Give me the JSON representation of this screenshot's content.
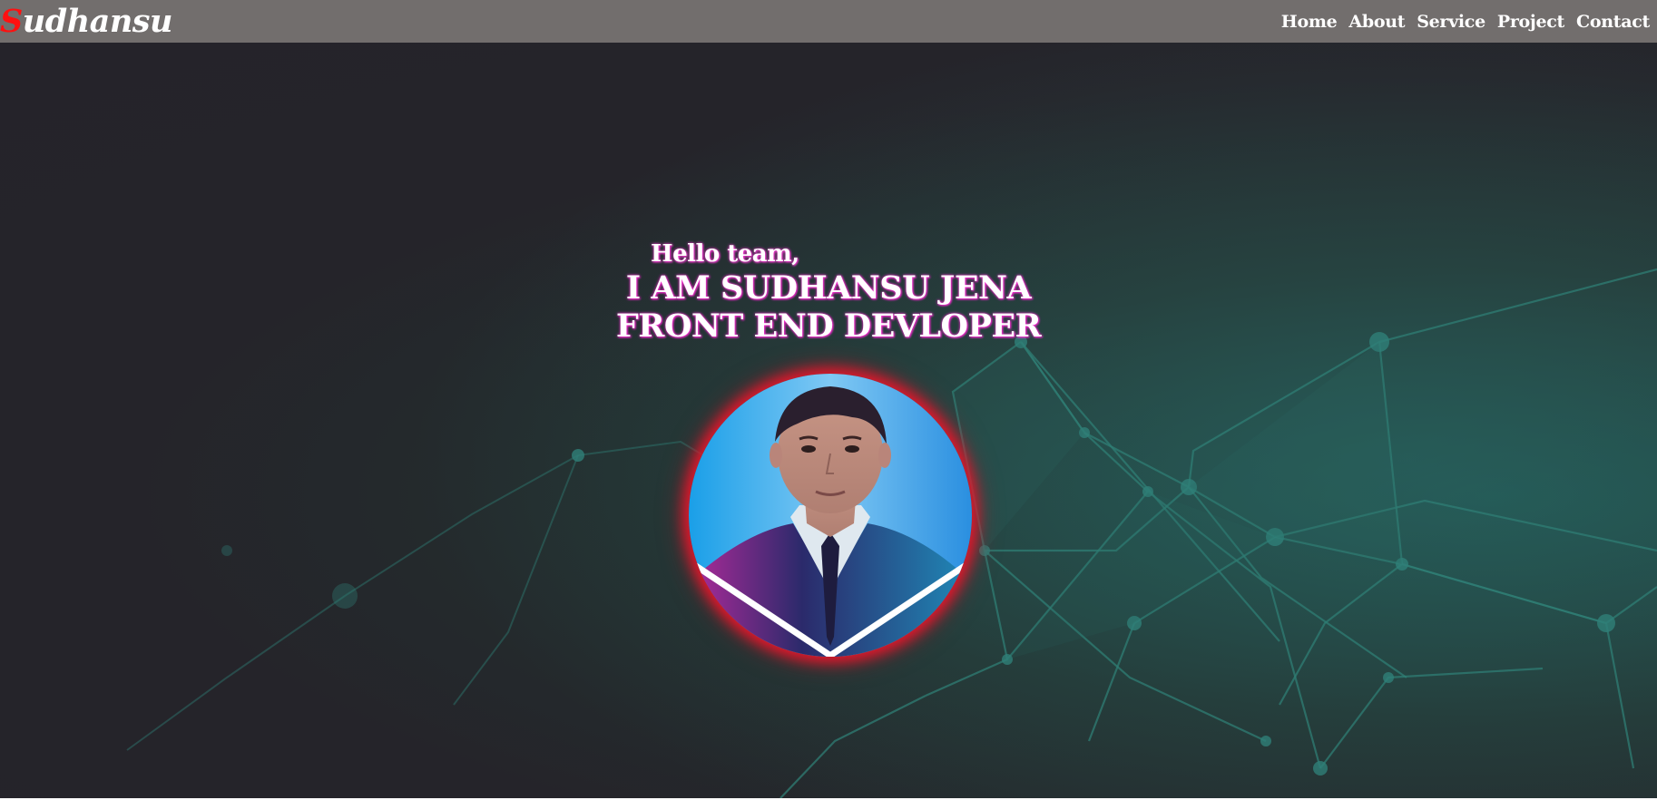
{
  "brand": {
    "initial": "S",
    "rest": "udhansu",
    "initial_color": "#ff1010"
  },
  "nav": {
    "items": [
      {
        "label": "Home"
      },
      {
        "label": "About"
      },
      {
        "label": "Service"
      },
      {
        "label": "Project"
      },
      {
        "label": "Contact"
      }
    ],
    "background_color": "#726e6d"
  },
  "hero": {
    "greeting": "Hello team,",
    "headline_line1": "I AM SUDHANSU JENA",
    "headline_line2": "FRONT END DEVLOPER",
    "text_glow_color": "#ff2ad6",
    "avatar_glow_color": "#e0182c",
    "background_icon": "network-mesh-graphic"
  }
}
